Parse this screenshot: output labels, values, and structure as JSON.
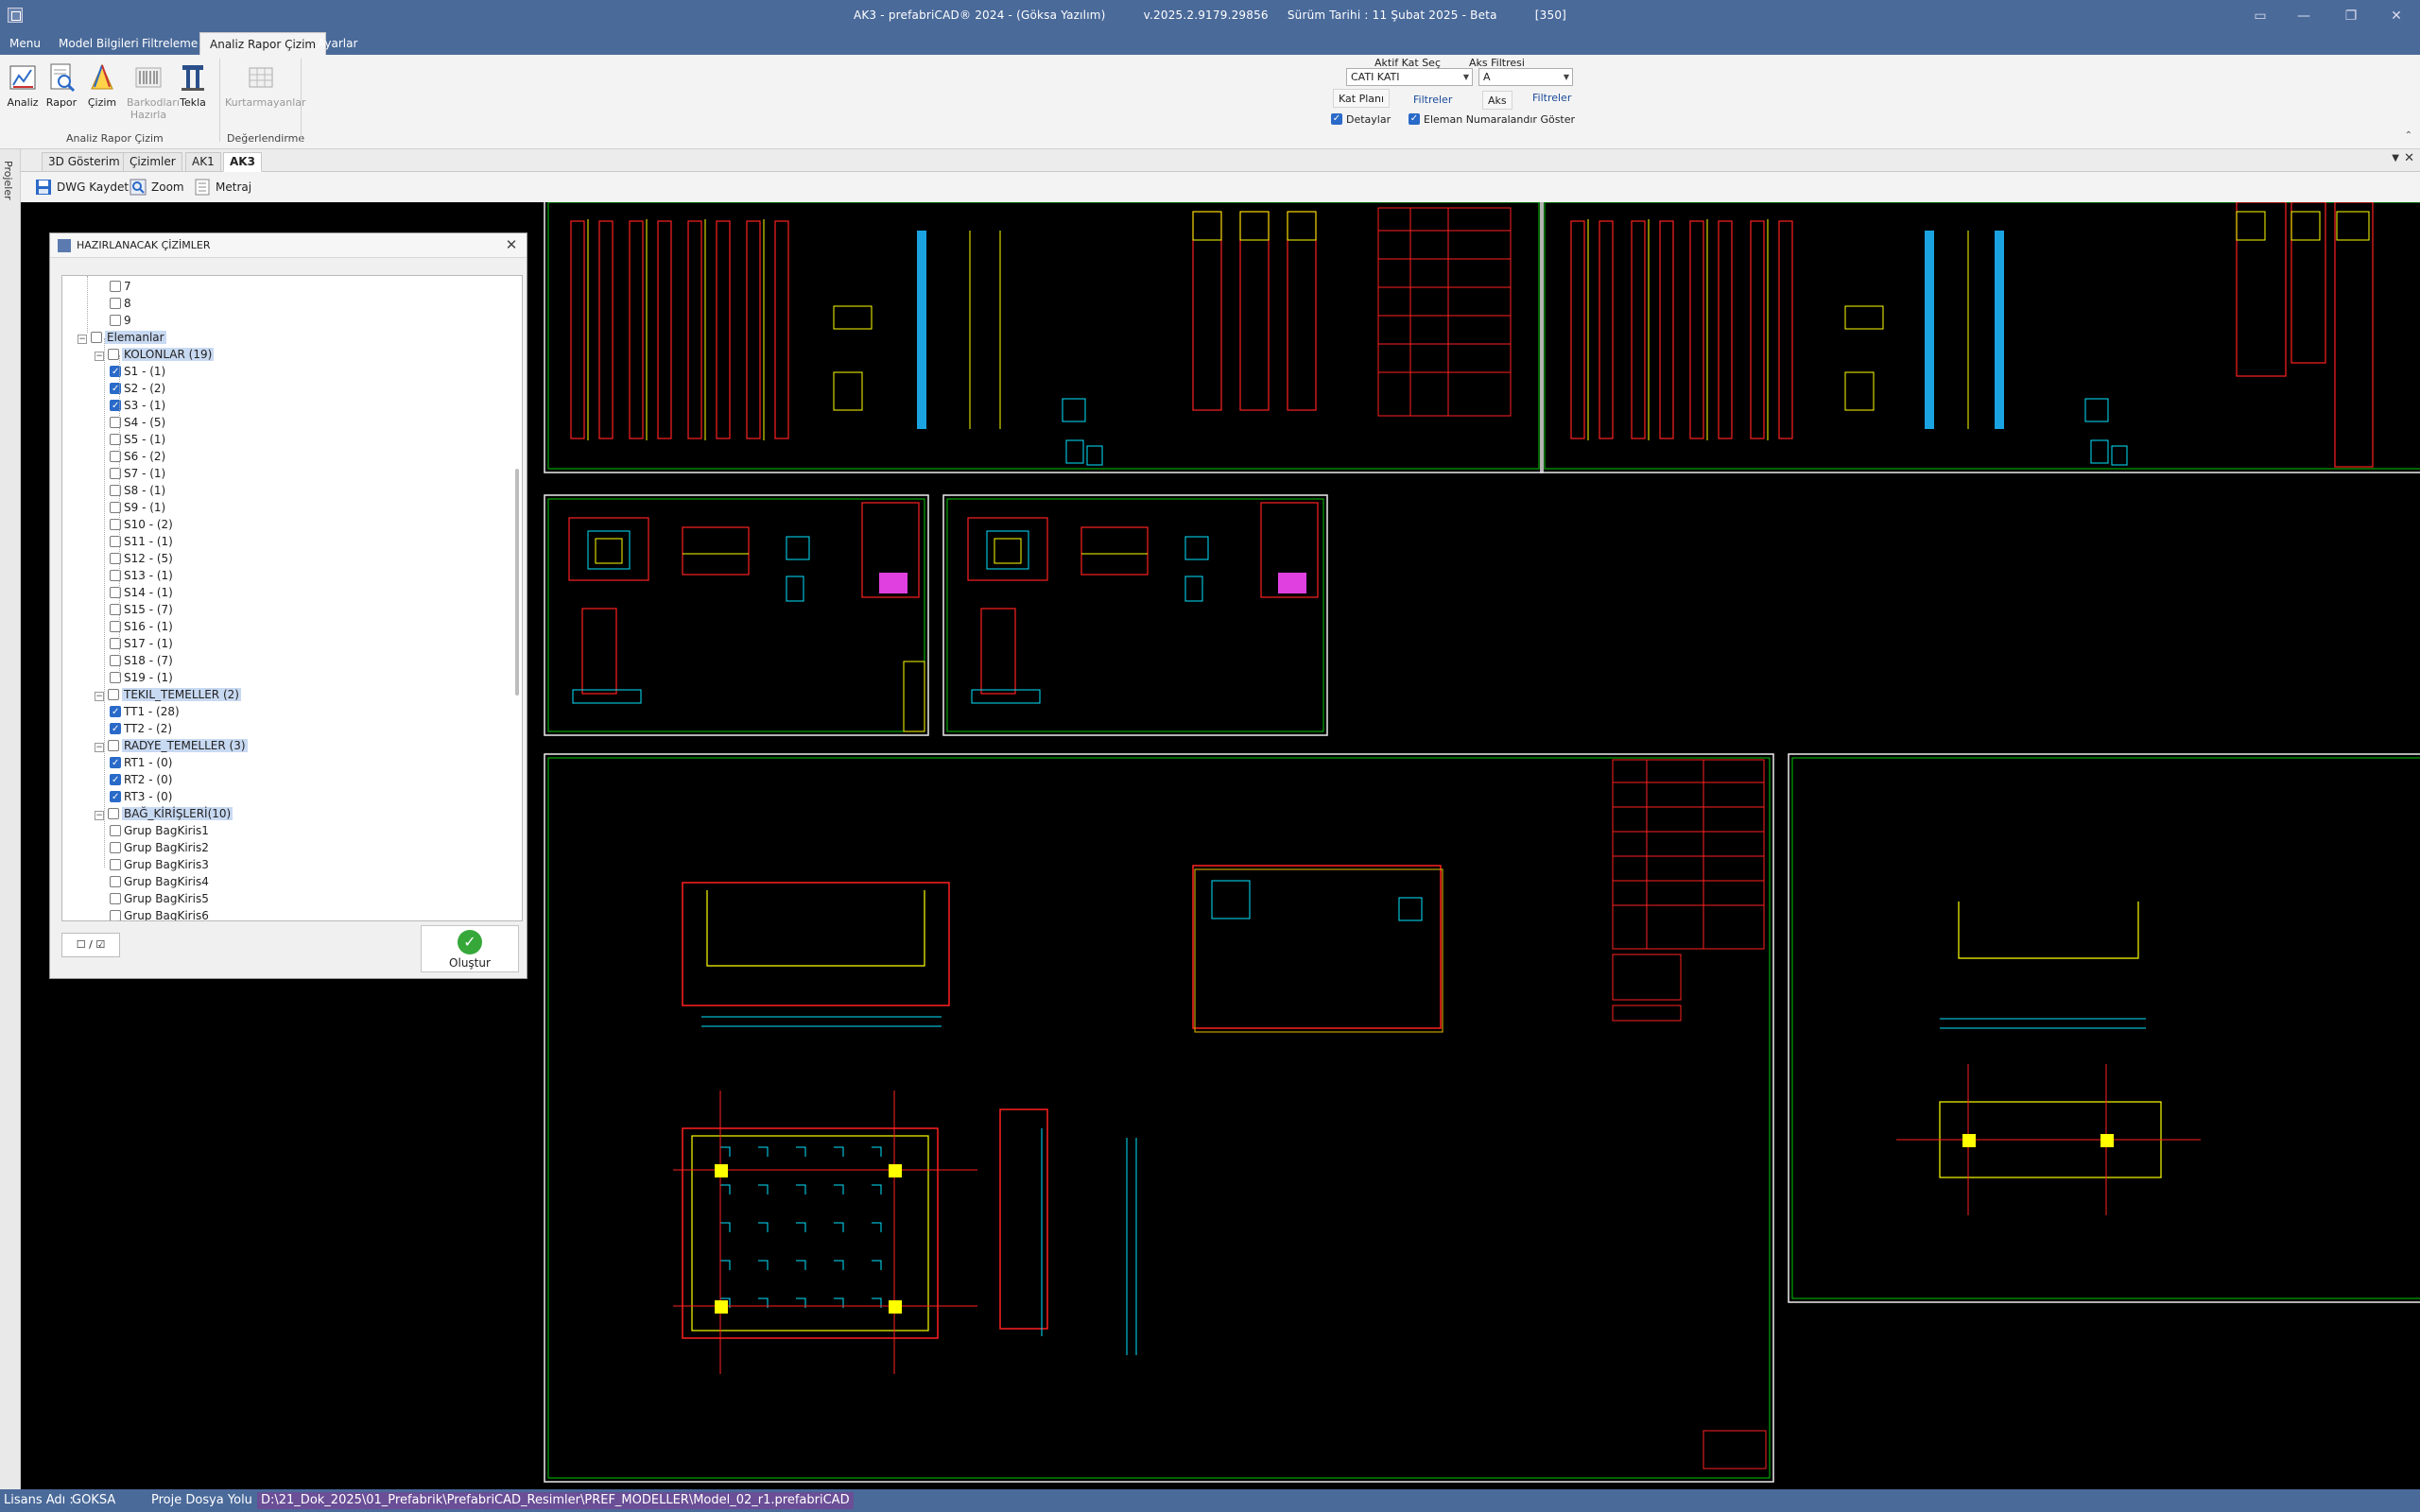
{
  "window": {
    "title": "AK3 - prefabriCAD® 2024 - (Göksa Yazılım)          v.2025.2.9179.29856     Sürüm Tarihi : 11 Şubat 2025 - Beta          [350]"
  },
  "menu": {
    "tabs": [
      "Menu",
      "Model Bilgileri",
      "Filtreleme",
      "Analiz Rapor Çizim",
      "Ayarlar"
    ],
    "active": "Analiz Rapor Çizim"
  },
  "ribbon": {
    "buttons": {
      "analiz": "Analiz",
      "rapor": "Rapor",
      "cizim": "Çizim",
      "barkod": "Barkodları Hazırla",
      "tekla": "Tekla",
      "kurtarmayanlar": "Kurtarmayanlar"
    },
    "groups": {
      "analiz_rapor_cizim": "Analiz Rapor Çizim",
      "degerlendirme": "Değerlendirme"
    },
    "filters": {
      "aktif_kat_label": "Aktif Kat Seç",
      "aktif_kat_value": "CATI KATI",
      "aks_filtresi_label": "Aks Filtresi",
      "aks_filtresi_value": "A",
      "kat_plani": "Kat Planı",
      "filtreler1": "Filtreler",
      "aks": "Aks",
      "filtreler2": "Filtreler",
      "detaylar": "Detaylar",
      "eleman_numaralandir": "Eleman Numaralandır Göster"
    }
  },
  "doc_tabs": [
    "3D Gösterim",
    "Çizimler",
    "AK1",
    "AK3"
  ],
  "toolbar": {
    "dwg_kaydet": "DWG Kaydet",
    "zoom": "Zoom",
    "metraj": "Metraj"
  },
  "side_panel": {
    "label": "Projeler"
  },
  "dialog": {
    "title": "HAZIRLANACAK ÇİZİMLER",
    "tree": [
      {
        "label": "7",
        "checked": false,
        "level": 3
      },
      {
        "label": "8",
        "checked": false,
        "level": 3
      },
      {
        "label": "9",
        "checked": false,
        "level": 3
      },
      {
        "label": "Elemanlar",
        "checked": false,
        "level": 1,
        "group": true
      },
      {
        "label": "KOLONLAR (19)",
        "checked": false,
        "level": 2,
        "group": true
      },
      {
        "label": "S1 - (1)",
        "checked": true,
        "level": 3
      },
      {
        "label": "S2 - (2)",
        "checked": true,
        "level": 3
      },
      {
        "label": "S3 - (1)",
        "checked": true,
        "level": 3
      },
      {
        "label": "S4 - (5)",
        "checked": false,
        "level": 3
      },
      {
        "label": "S5 - (1)",
        "checked": false,
        "level": 3
      },
      {
        "label": "S6 - (2)",
        "checked": false,
        "level": 3
      },
      {
        "label": "S7 - (1)",
        "checked": false,
        "level": 3
      },
      {
        "label": "S8 - (1)",
        "checked": false,
        "level": 3
      },
      {
        "label": "S9 - (1)",
        "checked": false,
        "level": 3
      },
      {
        "label": "S10 - (2)",
        "checked": false,
        "level": 3
      },
      {
        "label": "S11 - (1)",
        "checked": false,
        "level": 3
      },
      {
        "label": "S12 - (5)",
        "checked": false,
        "level": 3
      },
      {
        "label": "S13 - (1)",
        "checked": false,
        "level": 3
      },
      {
        "label": "S14 - (1)",
        "checked": false,
        "level": 3
      },
      {
        "label": "S15 - (7)",
        "checked": false,
        "level": 3
      },
      {
        "label": "S16 - (1)",
        "checked": false,
        "level": 3
      },
      {
        "label": "S17 - (1)",
        "checked": false,
        "level": 3
      },
      {
        "label": "S18 - (7)",
        "checked": false,
        "level": 3
      },
      {
        "label": "S19 - (1)",
        "checked": false,
        "level": 3
      },
      {
        "label": "TEKIL_TEMELLER (2)",
        "checked": false,
        "level": 2,
        "group": true
      },
      {
        "label": "TT1 - (28)",
        "checked": true,
        "level": 3
      },
      {
        "label": "TT2 - (2)",
        "checked": true,
        "level": 3
      },
      {
        "label": "RADYE_TEMELLER (3)",
        "checked": false,
        "level": 2,
        "group": true
      },
      {
        "label": "RT1 - (0)",
        "checked": true,
        "level": 3
      },
      {
        "label": "RT2 - (0)",
        "checked": true,
        "level": 3
      },
      {
        "label": "RT3 - (0)",
        "checked": true,
        "level": 3
      },
      {
        "label": "BAĞ_KİRİŞLERİ(10)",
        "checked": false,
        "level": 2,
        "group": true
      },
      {
        "label": "Grup BagKiris1",
        "checked": false,
        "level": 3
      },
      {
        "label": "Grup BagKiris2",
        "checked": false,
        "level": 3
      },
      {
        "label": "Grup BagKiris3",
        "checked": false,
        "level": 3
      },
      {
        "label": "Grup BagKiris4",
        "checked": false,
        "level": 3
      },
      {
        "label": "Grup BagKiris5",
        "checked": false,
        "level": 3
      },
      {
        "label": "Grup BagKiris6",
        "checked": false,
        "level": 3
      }
    ],
    "toggle_all": "☐ / ☑",
    "create": "Oluştur"
  },
  "status": {
    "license_label": "Lisans Adı :",
    "license_value": "GOKSA",
    "project_label": "Proje Dosya Yolu :",
    "project_path": "D:\\21_Dok_2025\\01_Prefabrik\\PrefabriCAD_Resimler\\PREF_MODELLER\\Model_02_r1.prefabriCAD"
  },
  "colors": {
    "titlebar": "#4a6a9a",
    "cad_background": "#000000",
    "cad_frame": "#ffffff",
    "cad_red": "#ff2020",
    "cad_yellow": "#ffff00",
    "cad_cyan": "#00e5ff",
    "cad_green": "#00c800",
    "accent": "#2a6ac8"
  }
}
